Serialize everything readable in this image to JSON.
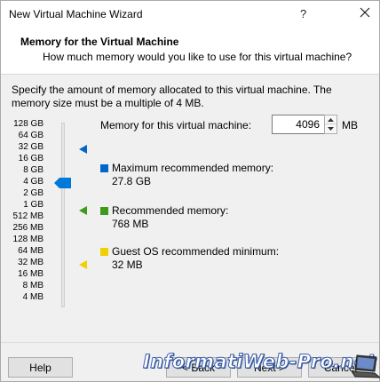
{
  "window": {
    "title": "New Virtual Machine Wizard",
    "help_glyph": "?",
    "close_glyph": "✕"
  },
  "header": {
    "title": "Memory for the Virtual Machine",
    "subtitle": "How much memory would you like to use for this virtual machine?"
  },
  "description": "Specify the amount of memory allocated to this virtual machine. The memory size must be a multiple of 4 MB.",
  "scale": {
    "labels": [
      "128 GB",
      "64 GB",
      "32 GB",
      "16 GB",
      "8 GB",
      "4 GB",
      "2 GB",
      "1 GB",
      "512 MB",
      "256 MB",
      "128 MB",
      "64 MB",
      "32 MB",
      "16 MB",
      "8 MB",
      "4 MB"
    ],
    "selected": "4 GB"
  },
  "memory": {
    "label": "Memory for this virtual machine:",
    "value": "4096",
    "unit": "MB"
  },
  "legend": {
    "max": {
      "label": "Maximum recommended memory:",
      "value": "27.8 GB",
      "color": "#0066c8"
    },
    "recommended": {
      "label": "Recommended memory:",
      "value": "768 MB",
      "color": "#3d9a1c"
    },
    "guest_min": {
      "label": "Guest OS recommended minimum:",
      "value": "32 MB",
      "color": "#f0d000"
    }
  },
  "buttons": {
    "help": "Help",
    "back": "< Back",
    "next": "Next >",
    "cancel": "Cancel"
  },
  "watermark": "InformatiWeb-Pro.net"
}
